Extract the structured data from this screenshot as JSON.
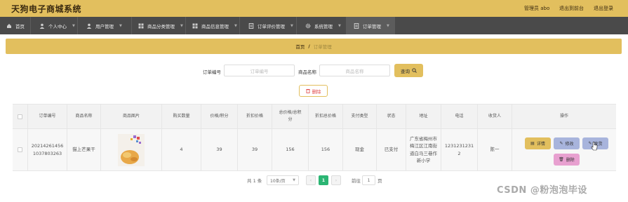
{
  "app": {
    "title": "天狗电子商城系统",
    "admin": "管理员 abo",
    "backend": "退出到前台",
    "logout": "退出登录"
  },
  "nav": [
    {
      "label": "首页",
      "icon": "home-icon"
    },
    {
      "label": "个人中心",
      "icon": "user-icon"
    },
    {
      "label": "用户管理",
      "icon": "user-icon"
    },
    {
      "label": "商品分类管理",
      "icon": "grid-icon"
    },
    {
      "label": "商品信息管理",
      "icon": "grid-icon"
    },
    {
      "label": "订单评价管理",
      "icon": "doc-icon"
    },
    {
      "label": "系统管理",
      "icon": "gear-icon"
    },
    {
      "label": "订单管理",
      "icon": "doc-icon"
    }
  ],
  "breadcrumb": {
    "home": "首页",
    "sep": "/",
    "current": "订单管理"
  },
  "search": {
    "order_label": "订单编号",
    "order_placeholder": "订单编号",
    "product_label": "商品名称",
    "product_placeholder": "商品名称",
    "button": "查询",
    "delete": "删除"
  },
  "table": {
    "headers": [
      "订单编号",
      "商品名称",
      "商品图片",
      "购买数量",
      "价格/积分",
      "折扣价格",
      "总价格/总积分",
      "折扣总价格",
      "支付类型",
      "状态",
      "地址",
      "电话",
      "收货人",
      "操作"
    ],
    "row": {
      "order_no": "20214261456 1037803263",
      "product": "猫上芒果干",
      "quantity": "4",
      "price": "39",
      "discount_price": "39",
      "total": "156",
      "discount_total": "156",
      "pay_type": "现金",
      "status": "已支付",
      "address": "广东省梅州市梅江区江南街道白马三巷作新小学",
      "phone": "1231231231 2",
      "receiver": "陈一"
    },
    "actions": {
      "detail": "详情",
      "edit": "修改",
      "ship": "发货",
      "delete": "删除"
    }
  },
  "pagination": {
    "total": "共 1 条",
    "page_size": "10条/页",
    "prev": "‹",
    "current": "1",
    "next": "›",
    "goto": "前往",
    "goto_value": "1",
    "page_unit": "页"
  },
  "watermark": "CSDN @粉泡泡毕设",
  "colors": {
    "accent": "#e2bf5e",
    "nav": "#4a4a4a",
    "edit": "#a8b4dc",
    "delete": "#e8a0d0",
    "page_active": "#2bb573"
  }
}
